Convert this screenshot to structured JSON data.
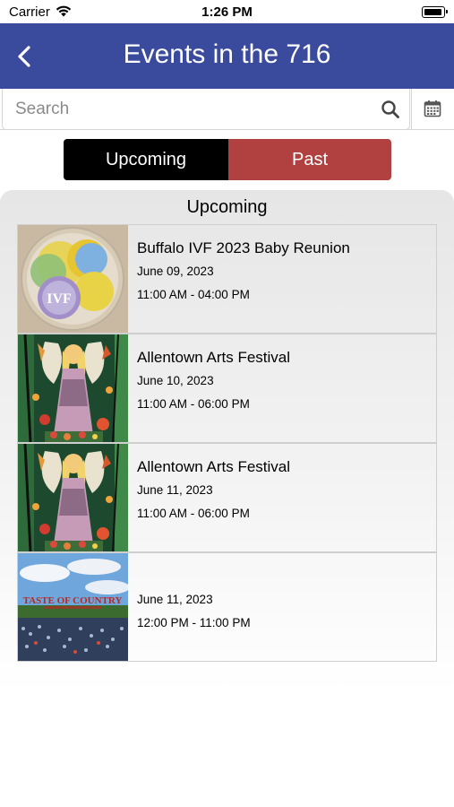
{
  "status_bar": {
    "carrier": "Carrier",
    "time": "1:26 PM"
  },
  "nav": {
    "title": "Events in the 716",
    "back_icon": "chevron-left-icon"
  },
  "search": {
    "placeholder": "Search",
    "value": "",
    "search_icon": "search-icon",
    "calendar_icon": "calendar-icon"
  },
  "tabs": {
    "upcoming_label": "Upcoming",
    "past_label": "Past",
    "selected": "Upcoming"
  },
  "section": {
    "header": "Upcoming"
  },
  "events": [
    {
      "title": "Buffalo IVF 2023 Baby Reunion",
      "date": "June 09, 2023",
      "time": "11:00 AM - 04:00 PM",
      "image": "ivf-logo",
      "image_text": "IVF"
    },
    {
      "title": "Allentown Arts Festival",
      "date": "June 10, 2023",
      "time": "11:00 AM - 06:00 PM",
      "image": "fairy-artwork"
    },
    {
      "title": "Allentown Arts Festival",
      "date": "June 11, 2023",
      "time": "11:00 AM - 06:00 PM",
      "image": "fairy-artwork"
    },
    {
      "title": "",
      "date": "June 11, 2023",
      "time": "12:00 PM - 11:00 PM",
      "image": "taste-of-country-photo",
      "image_text": "TASTE OF COUNTRY"
    }
  ],
  "colors": {
    "nav_background": "#3a4b9e",
    "upcoming_tab": "#000000",
    "past_tab": "#b14040"
  }
}
